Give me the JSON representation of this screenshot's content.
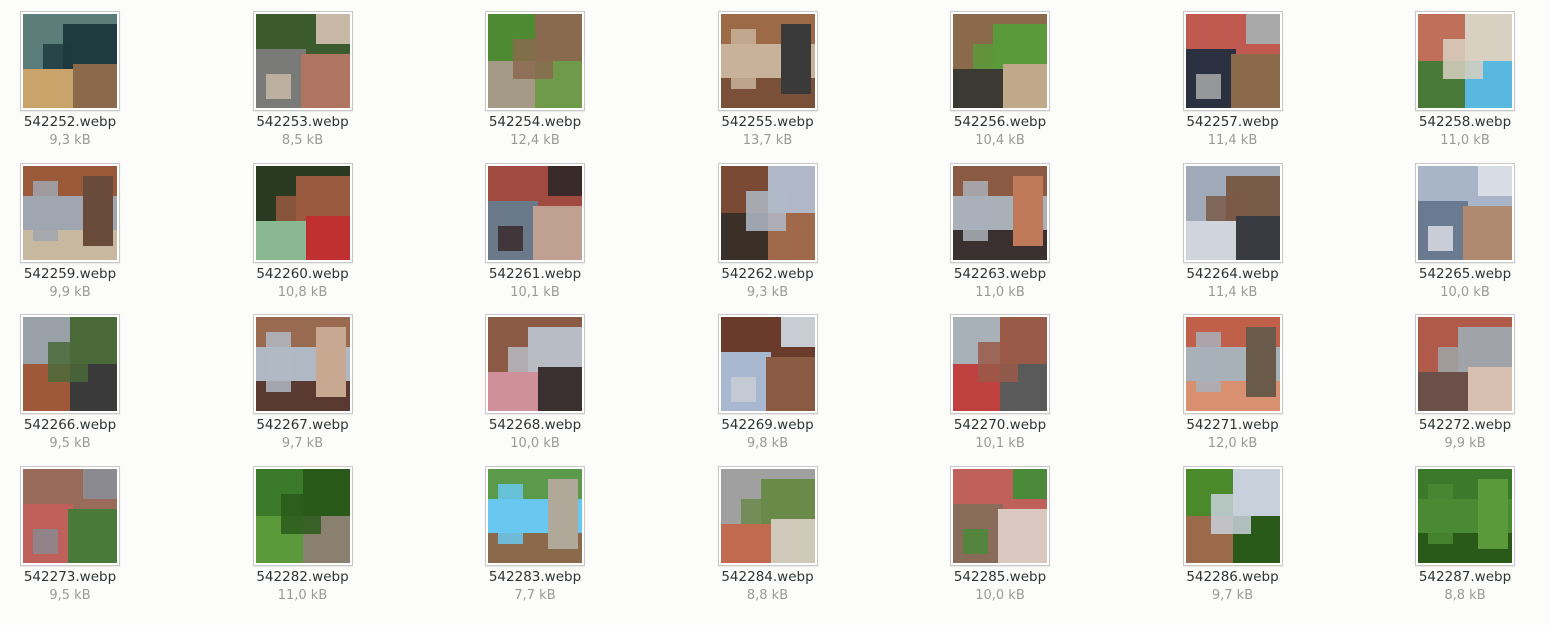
{
  "files": [
    {
      "name": "542252.webp",
      "size": "9,3 kB",
      "colors": [
        "#5b7d7a",
        "#1f3b40",
        "#c9a36a",
        "#8a6a4a"
      ]
    },
    {
      "name": "542253.webp",
      "size": "8,5 kB",
      "colors": [
        "#3c5b2c",
        "#7a7a78",
        "#b07560",
        "#c8b9a6"
      ]
    },
    {
      "name": "542254.webp",
      "size": "12,4 kB",
      "colors": [
        "#4e8a32",
        "#8a6a4e",
        "#a59a85",
        "#6e9a4a"
      ]
    },
    {
      "name": "542255.webp",
      "size": "13,7 kB",
      "colors": [
        "#9c6a46",
        "#c8b29a",
        "#7a5038",
        "#3a3a3a"
      ]
    },
    {
      "name": "542256.webp",
      "size": "10,4 kB",
      "colors": [
        "#8a6a4a",
        "#5a9a3a",
        "#3a3a32",
        "#c0a88a"
      ]
    },
    {
      "name": "542257.webp",
      "size": "11,4 kB",
      "colors": [
        "#c05a50",
        "#2a3040",
        "#8a6a4a",
        "#a9a9a9"
      ]
    },
    {
      "name": "542258.webp",
      "size": "11,0 kB",
      "colors": [
        "#c0705a",
        "#d8d0c0",
        "#4a7a3a",
        "#58b8e0"
      ]
    },
    {
      "name": "542259.webp",
      "size": "9,9 kB",
      "colors": [
        "#9a5a3a",
        "#a0a6b0",
        "#c8b8a0",
        "#6a4a3a"
      ]
    },
    {
      "name": "542260.webp",
      "size": "10,8 kB",
      "colors": [
        "#2a3a20",
        "#9a5a40",
        "#8ab890",
        "#c03030"
      ]
    },
    {
      "name": "542261.webp",
      "size": "10,1 kB",
      "colors": [
        "#a04a40",
        "#6a7a8a",
        "#c0a090",
        "#3a2a2a"
      ]
    },
    {
      "name": "542262.webp",
      "size": "9,3 kB",
      "colors": [
        "#7a4a34",
        "#b0b8c8",
        "#3a3028",
        "#a06a4a"
      ]
    },
    {
      "name": "542263.webp",
      "size": "11,0 kB",
      "colors": [
        "#8a5a42",
        "#aab0b8",
        "#3a3030",
        "#c07a5a"
      ]
    },
    {
      "name": "542264.webp",
      "size": "11,4 kB",
      "colors": [
        "#a0aab8",
        "#7a5a48",
        "#d0d4dc",
        "#3a3a42"
      ]
    },
    {
      "name": "542265.webp",
      "size": "10,0 kB",
      "colors": [
        "#a8b4c8",
        "#6a7a90",
        "#b08a70",
        "#d8dce4"
      ]
    },
    {
      "name": "542266.webp",
      "size": "9,5 kB",
      "colors": [
        "#9aa0a8",
        "#4a6a3a",
        "#a0583a",
        "#3a3a3a"
      ]
    },
    {
      "name": "542267.webp",
      "size": "9,7 kB",
      "colors": [
        "#9a6a50",
        "#b0b8c4",
        "#5a3a30",
        "#c8a890"
      ]
    },
    {
      "name": "542268.webp",
      "size": "10,0 kB",
      "colors": [
        "#8a5a44",
        "#b8bcc4",
        "#d0909a",
        "#3a3030"
      ]
    },
    {
      "name": "542269.webp",
      "size": "9,8 kB",
      "colors": [
        "#6a3a2a",
        "#a8b8d0",
        "#8a5a42",
        "#c8ccd4"
      ]
    },
    {
      "name": "542270.webp",
      "size": "10,1 kB",
      "colors": [
        "#a8b0b8",
        "#9a5a48",
        "#c04040",
        "#5a5a5a"
      ]
    },
    {
      "name": "542271.webp",
      "size": "12,0 kB",
      "colors": [
        "#c0604a",
        "#a8b0b8",
        "#d89070",
        "#6a5a4a"
      ]
    },
    {
      "name": "542272.webp",
      "size": "9,9 kB",
      "colors": [
        "#b05a4a",
        "#a0a4a8",
        "#6a5048",
        "#d8c0b0"
      ]
    },
    {
      "name": "542273.webp",
      "size": "9,5 kB",
      "colors": [
        "#9a6a5a",
        "#c0605a",
        "#4a7a3a",
        "#8a8a90"
      ]
    },
    {
      "name": "542282.webp",
      "size": "11,0 kB",
      "colors": [
        "#3a7a2a",
        "#2a5a1a",
        "#5a9a3a",
        "#8a8070"
      ]
    },
    {
      "name": "542283.webp",
      "size": "7,7 kB",
      "colors": [
        "#5a9a4a",
        "#68c8f0",
        "#8a6a4a",
        "#b0a898"
      ]
    },
    {
      "name": "542284.webp",
      "size": "8,8 kB",
      "colors": [
        "#a0a0a0",
        "#6a8a4a",
        "#c06a50",
        "#d0c8b8"
      ]
    },
    {
      "name": "542285.webp",
      "size": "10,0 kB",
      "colors": [
        "#c0605a",
        "#8a6a58",
        "#d8c8c0",
        "#4a8a3a"
      ]
    },
    {
      "name": "542286.webp",
      "size": "9,7 kB",
      "colors": [
        "#4a8a2a",
        "#c8d0dc",
        "#9a6a4a",
        "#2a5a1a"
      ]
    },
    {
      "name": "542287.webp",
      "size": "8,8 kB",
      "colors": [
        "#3a7a2a",
        "#4a8a32",
        "#2a5a1a",
        "#5a9a3a"
      ]
    }
  ]
}
